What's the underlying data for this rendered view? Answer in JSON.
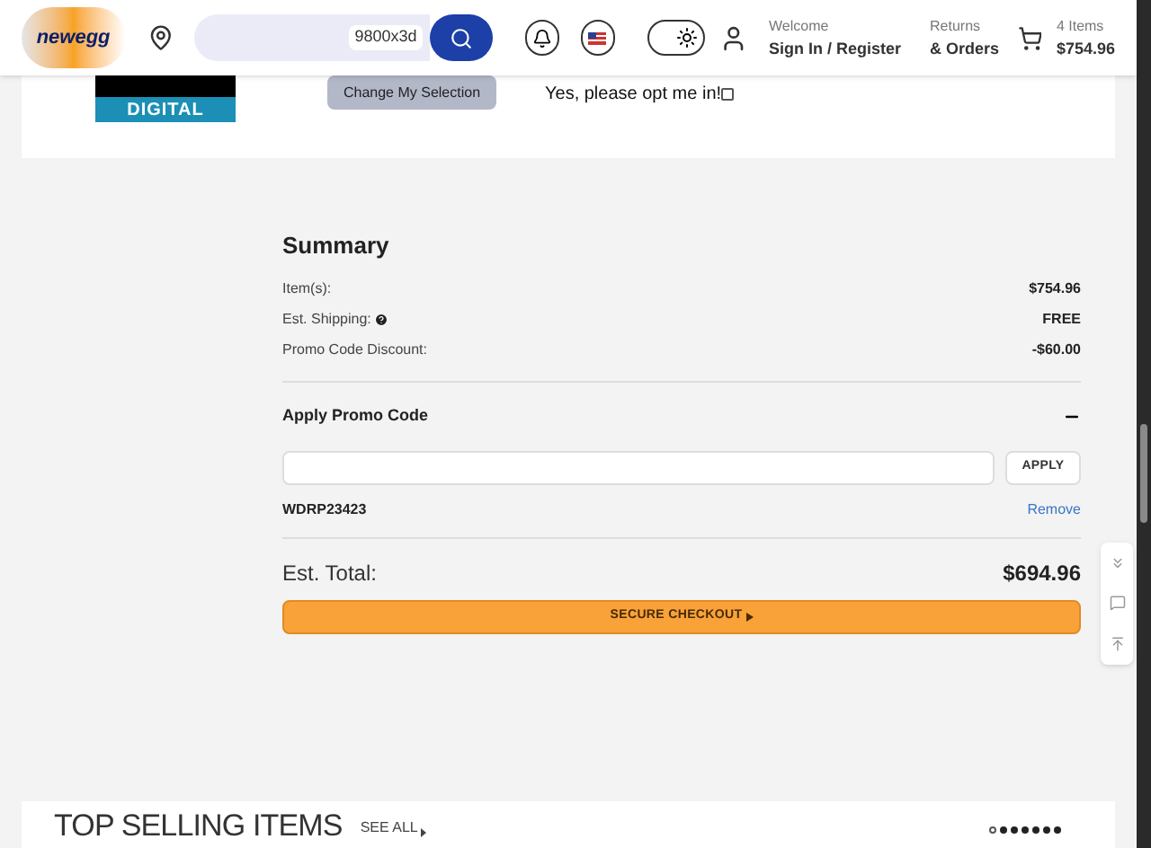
{
  "header": {
    "logo": "newegg",
    "search": {
      "value": "9800x3d"
    },
    "theme_toggle": {
      "on": true
    },
    "account": {
      "greeting": "Welcome",
      "link": "Sign In / Register"
    },
    "returns": {
      "line_1": "Returns",
      "line_2": "& Orders"
    },
    "cart": {
      "count": "4 Items",
      "total": "$754.96"
    }
  },
  "digital_card": {
    "badge": "DIGITAL",
    "button": "Change My Selection",
    "opt_in": {
      "label": "Yes, please opt me in!",
      "checked": false
    }
  },
  "summary": {
    "title": "Summary",
    "lines": [
      {
        "label": "Item(s):",
        "value": "$754.96",
        "help": false
      },
      {
        "label": "Est. Shipping:",
        "value": "FREE",
        "help": true
      },
      {
        "label": "Promo Code Discount:",
        "value": "-$60.00",
        "help": false
      }
    ],
    "promo": {
      "title": "Apply Promo Code",
      "expanded": true,
      "button": "APPLY",
      "code": "WDRP23423",
      "remove": "Remove"
    },
    "total": {
      "label": "Est. Total:",
      "value": "$694.96"
    },
    "checkout": "SECURE CHECKOUT"
  },
  "top_selling": {
    "title": "TOP SELLING ITEMS",
    "see_all": "SEE ALL",
    "dots": [
      {
        "selected": true
      },
      {
        "selected": false
      },
      {
        "selected": false
      },
      {
        "selected": false
      },
      {
        "selected": false
      },
      {
        "selected": false
      },
      {
        "selected": false
      }
    ]
  }
}
